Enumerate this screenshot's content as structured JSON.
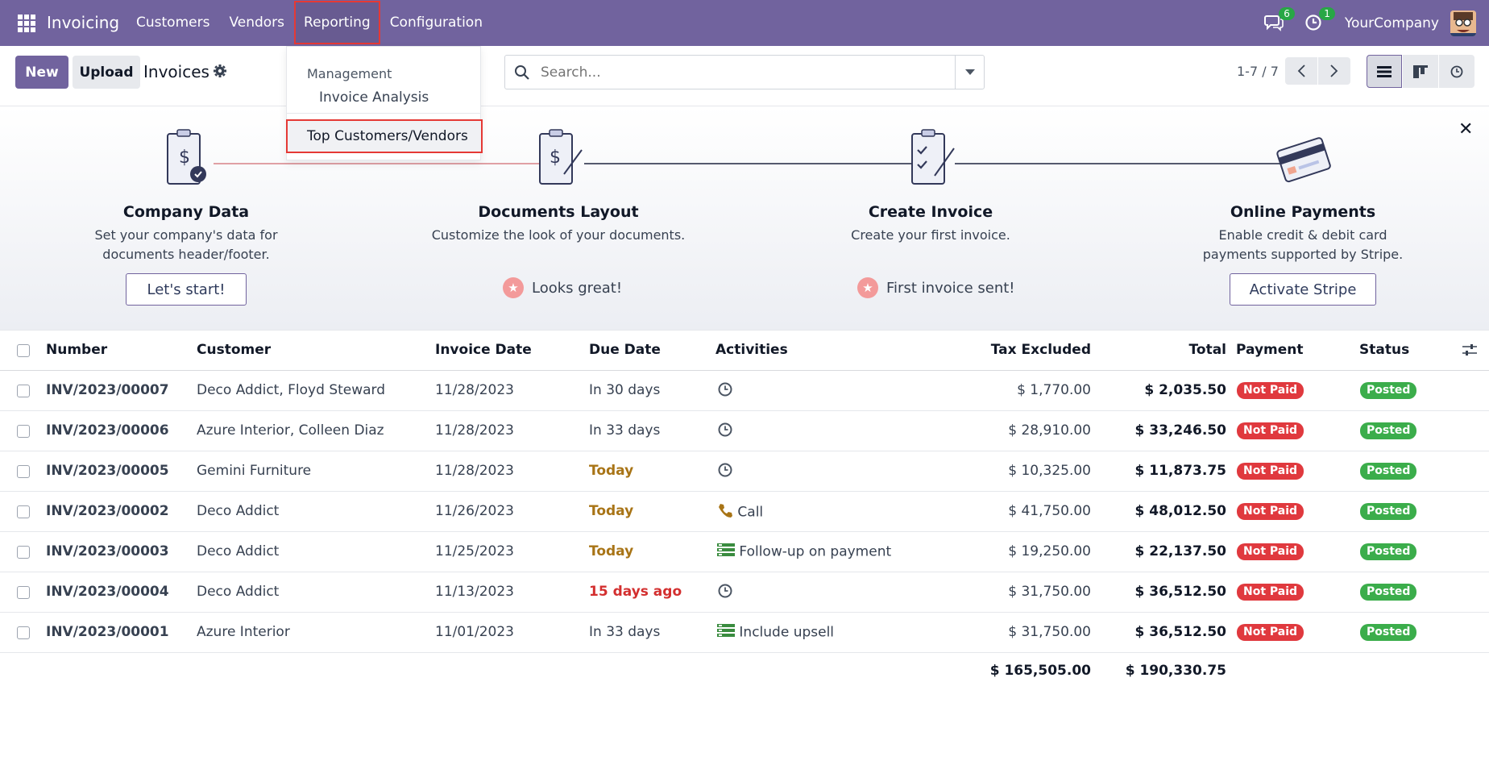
{
  "navbar": {
    "brand": "Invoicing",
    "menu": [
      "Customers",
      "Vendors",
      "Reporting",
      "Configuration"
    ],
    "messages_count": "6",
    "activities_count": "1",
    "company": "YourCompany"
  },
  "control": {
    "new_label": "New",
    "upload_label": "Upload",
    "title": "Invoices",
    "search_placeholder": "Search...",
    "pager": "1-7 / 7"
  },
  "reporting_menu": {
    "section": "Management",
    "items": [
      "Invoice Analysis",
      "Top Customers/Vendors"
    ]
  },
  "onboarding": {
    "steps": [
      {
        "title": "Company Data",
        "desc": "Set your company's data for documents header/footer.",
        "action": "Let's start!"
      },
      {
        "title": "Documents Layout",
        "desc": "Customize the look of your documents.",
        "status": "Looks great!"
      },
      {
        "title": "Create Invoice",
        "desc": "Create your first invoice.",
        "status": "First invoice sent!"
      },
      {
        "title": "Online Payments",
        "desc": "Enable credit & debit card payments supported by Stripe.",
        "action": "Activate Stripe"
      }
    ]
  },
  "table": {
    "headers": [
      "Number",
      "Customer",
      "Invoice Date",
      "Due Date",
      "Activities",
      "Tax Excluded",
      "Total",
      "Payment",
      "Status"
    ],
    "rows": [
      {
        "number": "INV/2023/00007",
        "customer": "Deco Addict, Floyd Steward",
        "date": "11/28/2023",
        "due": "In 30 days",
        "due_style": "normal",
        "activity": "",
        "activity_icon": "clock-icon",
        "tax_excluded": "$ 1,770.00",
        "total": "$ 2,035.50",
        "payment": "Not Paid",
        "status": "Posted"
      },
      {
        "number": "INV/2023/00006",
        "customer": "Azure Interior, Colleen Diaz",
        "date": "11/28/2023",
        "due": "In 33 days",
        "due_style": "normal",
        "activity": "",
        "activity_icon": "clock-icon",
        "tax_excluded": "$ 28,910.00",
        "total": "$ 33,246.50",
        "payment": "Not Paid",
        "status": "Posted"
      },
      {
        "number": "INV/2023/00005",
        "customer": "Gemini Furniture",
        "date": "11/28/2023",
        "due": "Today",
        "due_style": "today",
        "activity": "",
        "activity_icon": "clock-icon",
        "tax_excluded": "$ 10,325.00",
        "total": "$ 11,873.75",
        "payment": "Not Paid",
        "status": "Posted"
      },
      {
        "number": "INV/2023/00002",
        "customer": "Deco Addict",
        "date": "11/26/2023",
        "due": "Today",
        "due_style": "today",
        "activity": "Call",
        "activity_icon": "phone-icon",
        "tax_excluded": "$ 41,750.00",
        "total": "$ 48,012.50",
        "payment": "Not Paid",
        "status": "Posted"
      },
      {
        "number": "INV/2023/00003",
        "customer": "Deco Addict",
        "date": "11/25/2023",
        "due": "Today",
        "due_style": "today",
        "activity": "Follow-up on payment",
        "activity_icon": "tasks-icon",
        "tax_excluded": "$ 19,250.00",
        "total": "$ 22,137.50",
        "payment": "Not Paid",
        "status": "Posted"
      },
      {
        "number": "INV/2023/00004",
        "customer": "Deco Addict",
        "date": "11/13/2023",
        "due": "15 days ago",
        "due_style": "overdue",
        "activity": "",
        "activity_icon": "clock-icon",
        "tax_excluded": "$ 31,750.00",
        "total": "$ 36,512.50",
        "payment": "Not Paid",
        "status": "Posted"
      },
      {
        "number": "INV/2023/00001",
        "customer": "Azure Interior",
        "date": "11/01/2023",
        "due": "In 33 days",
        "due_style": "normal",
        "activity": "Include upsell",
        "activity_icon": "tasks-icon",
        "tax_excluded": "$ 31,750.00",
        "total": "$ 36,512.50",
        "payment": "Not Paid",
        "status": "Posted"
      }
    ],
    "totals": {
      "tax_excluded": "$ 165,505.00",
      "total": "$ 190,330.75"
    }
  },
  "colors": {
    "brand": "#71639e",
    "not_paid": "#e0393e",
    "posted": "#3bad4b",
    "today": "#a87416",
    "overdue": "#d32f2f"
  }
}
